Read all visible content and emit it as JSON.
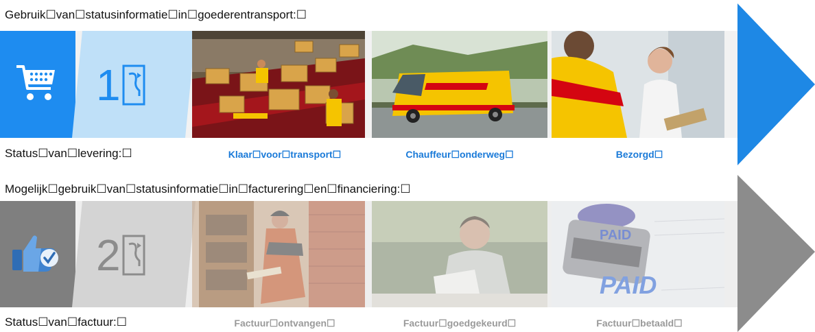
{
  "colors": {
    "blue_accent": "#1e8cf0",
    "blue_light": "#bfe0f8",
    "arrow_blue": "#1e88e5",
    "grey_dark": "#7f7f7f",
    "grey_light": "#d4d4d4",
    "arrow_grey": "#8c8c8c",
    "dhl_yellow": "#f5c400",
    "dhl_red": "#d40511"
  },
  "row1": {
    "heading": "Gebruik☐van☐statusinformatie☐in☐goederentransport:☐",
    "icon": "shopping-cart-icon",
    "number": "1",
    "glyph": "☐",
    "status_label": "Status☐van☐levering:☐",
    "steps": [
      {
        "caption": "Klaar☐voor☐transport☐",
        "photo": "dhl-warehouse-photo"
      },
      {
        "caption": "Chauffeur☐onderweg☐",
        "photo": "dhl-van-photo"
      },
      {
        "caption": "Bezorgd☐",
        "photo": "dhl-courier-delivery-photo"
      }
    ]
  },
  "row2": {
    "heading": "Mogelijk☐gebruik☐van☐statusinformatie☐in☐facturering☐en☐financiering:☐",
    "icon": "thumbs-up-icon",
    "number": "2",
    "glyph": "☐",
    "status_label": "Status☐van☐factuur:☐",
    "steps": [
      {
        "caption": "Factuur☐ontvangen☐",
        "photo": "mail-delivery-photo"
      },
      {
        "caption": "Factuur☐goedgekeurd☐",
        "photo": "man-reading-document-photo"
      },
      {
        "caption": "Factuur☐betaald☐",
        "photo": "paid-stamp-photo",
        "stamp_text": "PAID"
      }
    ]
  }
}
